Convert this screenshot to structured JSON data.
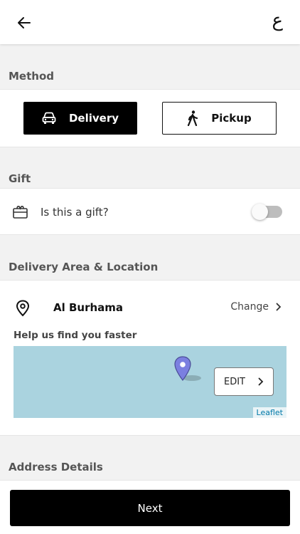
{
  "header": {
    "back_icon": "arrow-left-icon",
    "language_toggle": "ع"
  },
  "method": {
    "label": "Method",
    "options": [
      {
        "label": "Delivery",
        "icon": "car-icon",
        "selected": true
      },
      {
        "label": "Pickup",
        "icon": "walking-person-icon",
        "selected": false
      }
    ]
  },
  "gift": {
    "label": "Gift",
    "question": "Is this a gift?",
    "icon": "gift-box-icon",
    "enabled": false
  },
  "delivery": {
    "label": "Delivery Area & Location",
    "area": "Al Burhama",
    "change_label": "Change",
    "help_text": "Help us find you faster",
    "map": {
      "edit_label": "EDIT",
      "attribution": "Leaflet",
      "water_color": "#aad3df",
      "marker_color": "#7b7fe0"
    }
  },
  "address": {
    "label": "Address Details"
  },
  "footer": {
    "next_label": "Next"
  },
  "colors": {
    "primary": "#000000",
    "background": "#f2f2f2",
    "toggle_off": "#bdbdbd"
  }
}
